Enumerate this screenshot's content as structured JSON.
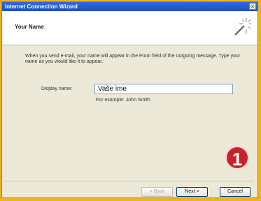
{
  "window": {
    "title": "Internet Connection Wizard",
    "close_label": "×"
  },
  "header": {
    "title": "Your Name",
    "icon": "wizard-wand-icon"
  },
  "content": {
    "description": "When you send e-mail, your name will appear in the From field of the outgoing message. Type your name as you would like it to appear.",
    "display_name_label": "Display name:",
    "display_name_value": "Vaše ime",
    "example_text": "For example: John Smith"
  },
  "badge": {
    "number": "1",
    "color": "#c8232a"
  },
  "buttons": {
    "back_label": "< Back",
    "next_label": "Next >",
    "cancel_label": "Cancel"
  },
  "colors": {
    "title_bar": "#2d6ae0",
    "border_frame": "#f2b21e"
  }
}
